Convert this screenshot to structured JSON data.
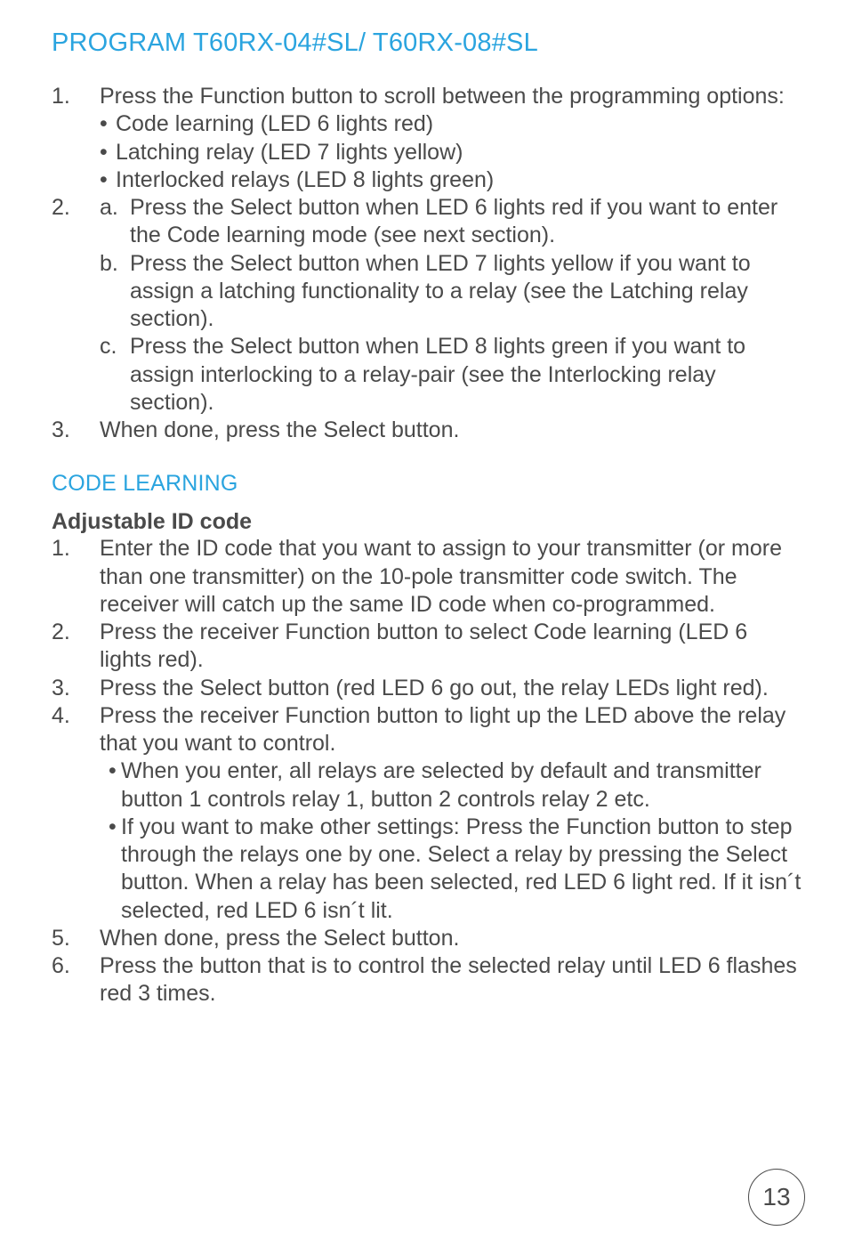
{
  "title": "PROGRAM T60RX-04#SL/ T60RX-08#SL",
  "section1": {
    "item1_num": "1.",
    "item1_text": "Press the Function button to scroll between the programming options:",
    "bullets": [
      "Code learning (LED 6 lights red)",
      "Latching relay (LED 7 lights yellow)",
      "Interlocked relays (LED 8 lights green)"
    ],
    "item2_num": "2.",
    "subs": {
      "a_num": "a.",
      "a_text": "Press the Select button when LED 6 lights red if you want to enter the Code learning mode (see next section).",
      "b_num": "b.",
      "b_text": "Press the Select button when LED 7 lights yellow if you want to assign a latching functionality to a relay (see the Latching relay section).",
      "c_num": "c.",
      "c_text": "Press the Select button when LED 8 lights green if you want to assign interlocking to a relay-pair (see the Interlocking relay section)."
    },
    "item3_num": "3.",
    "item3_text": "When done, press the Select button."
  },
  "code_learning_heading": "CODE LEARNING",
  "adjustable_heading": "Adjustable ID code",
  "code_learning": {
    "i1_num": "1.",
    "i1_text": "Enter the ID code that you want to assign to your transmitter (or more than one transmitter) on the 10-pole transmitter code switch. The receiver will catch up the same ID code when co-programmed.",
    "i2_num": "2.",
    "i2_text": "Press the receiver Function button to select Code learning (LED 6 lights red).",
    "i3_num": "3.",
    "i3_text": "Press the Select button (red LED 6 go out, the relay LEDs light red).",
    "i4_num": "4.",
    "i4_text": "Press the receiver Function button to light up the LED above the relay that you want to control.",
    "i4_b1": "When you enter, all relays are selected by default and transmitter button 1 controls relay 1, button 2 controls relay 2 etc.",
    "i4_b2": "If you want to make other settings: Press the Function button to step through the relays one by one. Select a relay by pressing the Select button. When a relay has been selected, red LED 6 light red. If it isn´t selected, red LED 6 isn´t lit.",
    "i5_num": "5.",
    "i5_text": "When done, press the Select button.",
    "i6_num": "6.",
    "i6_text": "Press the button that is to control the selected relay until LED 6 flashes red 3 times."
  },
  "page_number": "13",
  "bullet_char": "•"
}
